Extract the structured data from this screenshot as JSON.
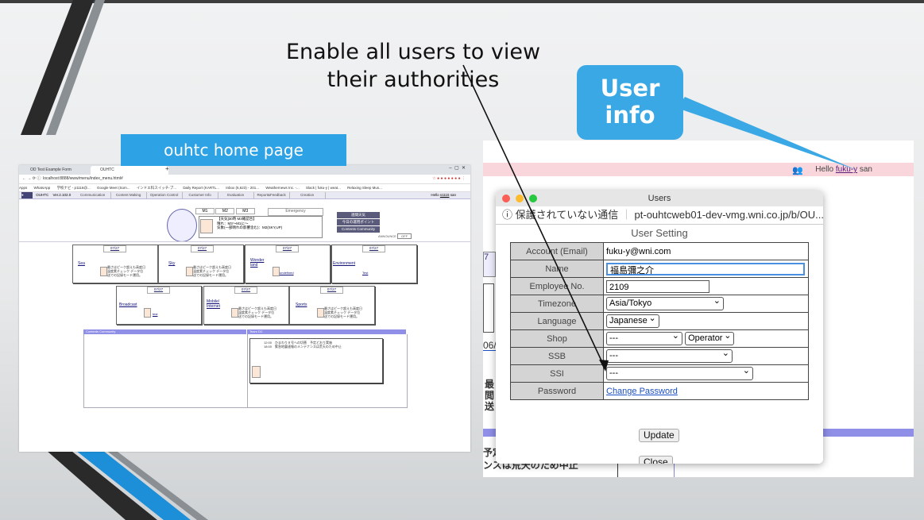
{
  "slide": {
    "title_line1": "Enable all users to view",
    "title_line2": "their authorities",
    "callout_line1": "User",
    "callout_line2": "info",
    "home_label": "ouhtc home page"
  },
  "browser": {
    "tabs": [
      "OD Test Example Form",
      "OUHTC"
    ],
    "url": "localhost:8888/www/menu/index_menu.html#",
    "bookmarks": [
      "Apps",
      "WhatsApp",
      "学校ナビ - p1116@...",
      "Google Meet (Som...",
      "インドエ科スイッチ-ブ...",
      "Daily Report (KARTL...",
      "Inbox (6,623) - 201...",
      "Weathernews Inc. -...",
      "Slack | fuku-y | weat...",
      "Relaxing Sleep Mus..."
    ],
    "site_name": "OUHTC",
    "version": "Ver.2.102.0",
    "nav": [
      "Communication",
      "Content Making",
      "Operation Control",
      "Customer Info",
      "Evaluation",
      "Report&Feedback",
      "Creation"
    ],
    "hello": "Hello",
    "hello_user": "s1115",
    "hello_suffix": "san",
    "emergency": "Emergency",
    "m_tabs": [
      "M1",
      "M2",
      "M3"
    ],
    "header_note_lines": [
      "【天気]30時 M3確認合】",
      "晴れ：M3～M1に～",
      "気象(一部晴れの影響含む)：M2(SKY,UP)"
    ],
    "header_buttons": [
      "週間天気",
      "今日の運用ポイント",
      "Contents Community"
    ],
    "ann_label": "ANNOUNCE",
    "ann_value": "OFF",
    "cards_row1": [
      {
        "name": "Sea",
        "date": "07/27",
        "sub": "undefined"
      },
      {
        "name": "Sky",
        "date": "07/27",
        "sub": ""
      },
      {
        "name": "Wonder land",
        "date": "07/27",
        "sub": "undefined"
      },
      {
        "name": "Environment",
        "date": "07/27",
        "sub": "Test"
      }
    ],
    "cards_row2": [
      {
        "name": "Broadcast",
        "date": "07/27",
        "sub": "test"
      },
      {
        "name": "Mobile/ Internet",
        "date": "07/27",
        "sub": ""
      },
      {
        "name": "Sports",
        "date": "07/27",
        "sub": ""
      }
    ],
    "card_text": "最さはピーク超えも高度日\n温度素チェック データ位\n送での記録モード運用。",
    "panel_left": "Contents Community",
    "panel_right": "Team DC",
    "team_notes": [
      "12:00　ひまわり８号への切替　予定どおり実施",
      "18:00　緊急地震速報のメンテナンスは荒天のため中止"
    ]
  },
  "right": {
    "hello": "Hello",
    "user": "fuku-y",
    "san": "san",
    "window_title": "Users",
    "security": "保護されていない通信",
    "address": "pt-ouhtcweb01-dev-vmg.wni.co.jp/b/OU...",
    "subtitle": "User Setting",
    "labels": {
      "account": "Account (Email)",
      "name": "Name",
      "employee": "Employee No.",
      "timezone": "Timezone",
      "language": "Language",
      "shop": "Shop",
      "ssb": "SSB",
      "ssi": "SSI",
      "password": "Password"
    },
    "values": {
      "account": "fuku-y@wni.com",
      "name": "福島彌之介",
      "employee": "2109",
      "timezone": "Asia/Tokyo",
      "language": "Japanese",
      "shop": "---",
      "shop_role": "Operator",
      "ssb": "---",
      "ssi": "---",
      "password_link": "Change Password"
    },
    "update": "Update",
    "close": "Close",
    "bg_fragments": {
      "left_tab": "7",
      "date": "06/",
      "kanji": "最\n閲\n送",
      "bottom1": "予定",
      "bottom2": "ンスは荒天のため中止"
    }
  },
  "colors": {
    "callout": "#3aa8e4",
    "home_label": "#2da3e6",
    "pink_bar": "#f8d6db",
    "panel_header": "#8f8fe8"
  }
}
